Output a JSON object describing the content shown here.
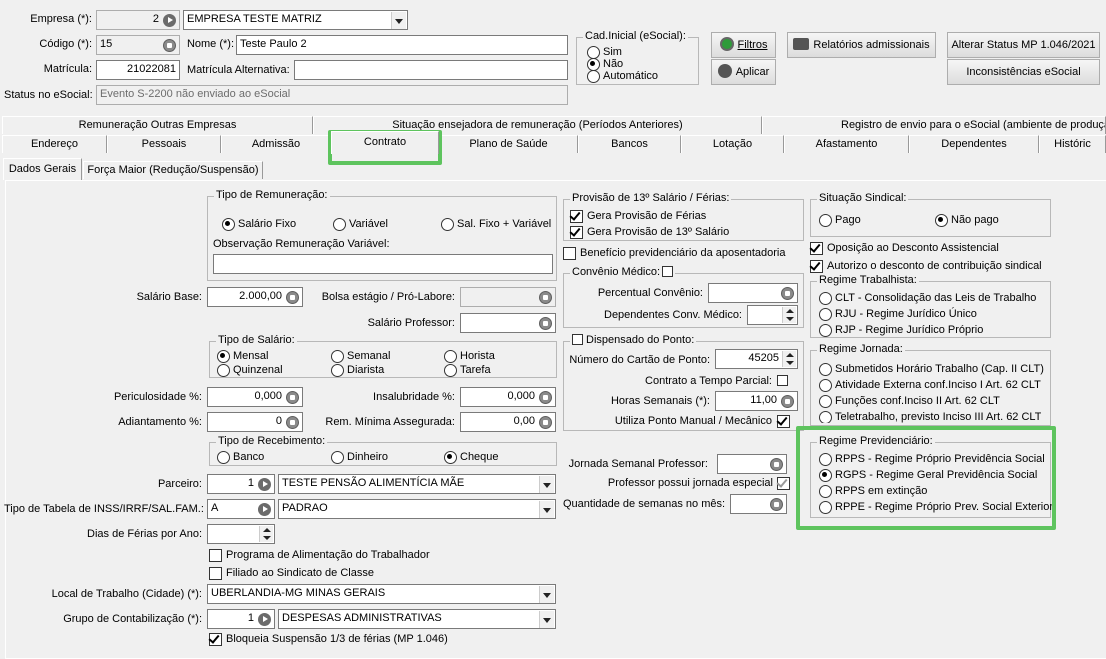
{
  "header": {
    "empresa_label": "Empresa (*):",
    "empresa_code": "2",
    "empresa_name": "EMPRESA TESTE MATRIZ",
    "codigo_label": "Código (*):",
    "codigo_value": "15",
    "nome_label": "Nome (*):",
    "nome_value": "Teste Paulo 2",
    "matricula_label": "Matrícula:",
    "matricula_value": "21022081",
    "matricula_alt_label": "Matrícula Alternativa:",
    "matricula_alt_value": "",
    "status_label": "Status no eSocial:",
    "status_value": "Evento S-2200 não enviado ao eSocial",
    "cad_inicial_title": "Cad.Inicial (eSocial):",
    "cad_opts": [
      "Sim",
      "Não",
      "Automático"
    ],
    "filtros": "Filtros",
    "aplicar": "Aplicar",
    "relatorios": "Relatórios admissionais",
    "alterar": "Alterar Status MP 1.046/2021",
    "inconsistencias": "Inconsistências eSocial"
  },
  "tabs_row1": [
    "Remuneração Outras Empresas",
    "Situação ensejadora de remuneração (Períodos Anteriores)",
    "Registro de envio para o eSocial (ambiente de produçã"
  ],
  "tabs_row2": [
    "Endereço",
    "Pessoais",
    "Admissão",
    "Contrato",
    "Plano de Saúde",
    "Bancos",
    "Lotação",
    "Afastamento",
    "Dependentes",
    "Históric"
  ],
  "subtabs": [
    "Dados Gerais",
    "Força Maior (Redução/Suspensão)"
  ],
  "left": {
    "tipo_rem_title": "Tipo de Remuneração:",
    "tipo_rem_opts": [
      "Salário Fixo",
      "Variável",
      "Sal. Fixo + Variável"
    ],
    "obs_label": "Observação Remuneração Variável:",
    "salario_base_label": "Salário Base:",
    "salario_base": "2.000,00",
    "bolsa_label": "Bolsa estágio / Pró-Labore:",
    "sal_prof_label": "Salário Professor:",
    "tipo_sal_title": "Tipo de Salário:",
    "tipo_sal_opts": [
      "Mensal",
      "Semanal",
      "Horista",
      "Quinzenal",
      "Diarista",
      "Tarefa"
    ],
    "peric_label": "Periculosidade %:",
    "peric": "0,000",
    "insal_label": "Insalubridade %:",
    "insal": "0,000",
    "adiant_label": "Adiantamento %:",
    "adiant": "0",
    "remmin_label": "Rem. Mínima Assegurada:",
    "remmin": "0,00",
    "tipo_rec_title": "Tipo de Recebimento:",
    "tipo_rec_opts": [
      "Banco",
      "Dinheiro",
      "Cheque"
    ],
    "parceiro_label": "Parceiro:",
    "parceiro_code": "1",
    "parceiro_name": "TESTE PENSÃO ALIMENTÍCIA MÃE",
    "tabela_label": "Tipo de Tabela de INSS/IRRF/SAL.FAM.:",
    "tabela_code": "A",
    "tabela_name": "PADRAO",
    "dias_ferias_label": "Dias de Férias por Ano:",
    "pat": "Programa de Alimentação do Trabalhador",
    "filiado": "Filiado ao Sindicato de Classe",
    "local_label": "Local de Trabalho (Cidade) (*):",
    "local_value": "UBERLANDIA-MG MINAS GERAIS",
    "grupo_label": "Grupo de Contabilização (*):",
    "grupo_code": "1",
    "grupo_name": "DESPESAS ADMINISTRATIVAS",
    "bloqueia": "Bloqueia Suspensão 1/3 de férias (MP 1.046)"
  },
  "middle": {
    "prov_title": "Provisão de 13º Salário / Férias:",
    "prov_ferias": "Gera Provisão de Férias",
    "prov_13": "Gera Provisão de 13º Salário",
    "beneficio": "Benefício previdenciário da aposentadoria",
    "convenio_title": "Convênio Médico:",
    "perc_conv_label": "Percentual Convênio:",
    "dep_conv_label": "Dependentes Conv. Médico:",
    "ponto_title": "Dispensado do Ponto:",
    "cartao_label": "Número do Cartão de Ponto:",
    "cartao": "45205",
    "parcial_label": "Contrato a Tempo Parcial:",
    "horas_label": "Horas Semanais (*):",
    "horas": "11,00",
    "manual_label": "Utiliza Ponto Manual / Mecânico",
    "jornada_prof_label": "Jornada Semanal Professor:",
    "prof_especial_label": "Professor possui jornada especial",
    "qtd_semanas_label": "Quantidade de semanas no mês:"
  },
  "right": {
    "sind_title": "Situação Sindical:",
    "sind_opts": [
      "Pago",
      "Não pago"
    ],
    "oposicao": "Oposição ao Desconto Assistencial",
    "autorizo": "Autorizo o desconto de contribuição sindical",
    "regime_trab_title": "Regime Trabalhista:",
    "regime_trab_opts": [
      "CLT - Consolidação das Leis de Trabalho",
      "RJU - Regime Jurídico Único",
      "RJP - Regime Jurídico Próprio"
    ],
    "regime_jor_title": "Regime Jornada:",
    "regime_jor_opts": [
      "Submetidos Horário Trabalho (Cap. II CLT)",
      "Atividade Externa conf.Inciso I Art. 62 CLT",
      "Funções conf.Inciso II Art. 62 CLT",
      "Teletrabalho, previsto Inciso III Art. 62 CLT"
    ],
    "regime_prev_title": "Regime Previdenciário:",
    "regime_prev_opts": [
      "RPPS - Regime Próprio Previdência Social",
      "RGPS - Regime Geral  Previdência Social",
      "RPPS em extinção",
      "RPPE - Regime Próprio Prev. Social Exterior"
    ]
  },
  "colors": {
    "highlight": "#5ec45e",
    "panel": "#f0f0f0"
  }
}
